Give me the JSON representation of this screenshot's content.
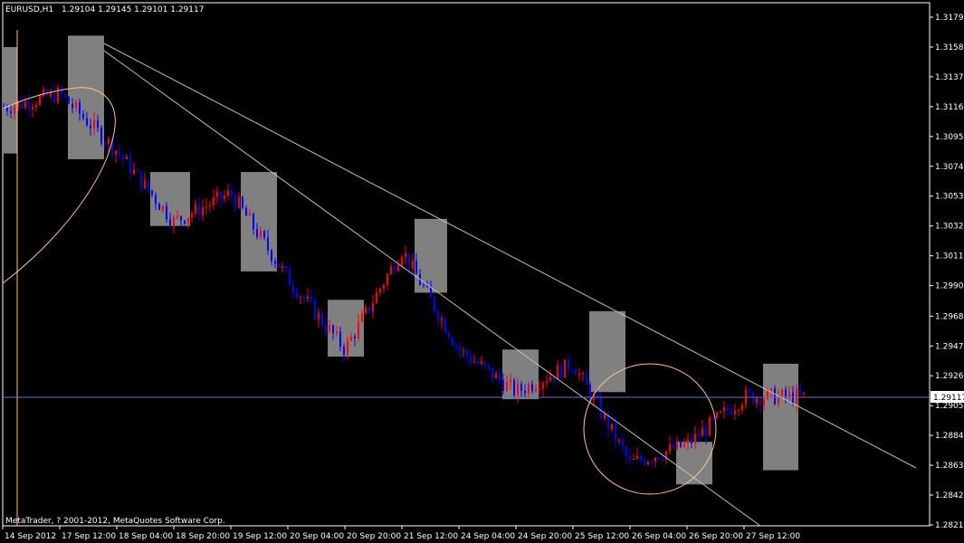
{
  "header": {
    "symbol_tf": "EURUSD,H1",
    "ohlc": "1.29104 1.29145 1.29101 1.29117"
  },
  "copyright": "MetaTrader, ? 2001-2012, MetaQuotes Software Corp.",
  "current_price_label": "1.29117",
  "colors": {
    "background": "#000000",
    "axis": "#ffffff",
    "bull_candle": "#ff0000",
    "bear_candle": "#0000ff",
    "box_fill": "#808080",
    "trendline": "#c0c0c0",
    "ellipse": "#ffc58a",
    "price_line": "#7070c0"
  },
  "chart_data": {
    "type": "candlestick",
    "symbol": "EURUSD",
    "timeframe": "H1",
    "ylim": [
      1.2815,
      1.318
    ],
    "y_ticks": [
      "1.31790",
      "1.31580",
      "1.31370",
      "1.31160",
      "1.30950",
      "1.30740",
      "1.30530",
      "1.30320",
      "1.30110",
      "1.29900",
      "1.29685",
      "1.29475",
      "1.29265",
      "1.29055",
      "1.28845",
      "1.28635",
      "1.28425",
      "1.28215"
    ],
    "x_ticks": [
      "14 Sep 2012",
      "17 Sep 12:00",
      "18 Sep 04:00",
      "18 Sep 20:00",
      "19 Sep 12:00",
      "20 Sep 04:00",
      "20 Sep 20:00",
      "21 Sep 12:00",
      "24 Sep 04:00",
      "24 Sep 20:00",
      "25 Sep 12:00",
      "26 Sep 04:00",
      "26 Sep 20:00",
      "27 Sep 12:00"
    ],
    "current_price": 1.29117,
    "approx_close_path": [
      {
        "time": "14 Sep 2012",
        "close": 1.3115
      },
      {
        "time": "17 Sep 12:00",
        "close": 1.3125
      },
      {
        "time": "18 Sep 04:00",
        "close": 1.3085
      },
      {
        "time": "18 Sep 20:00",
        "close": 1.3035
      },
      {
        "time": "19 Sep 12:00",
        "close": 1.3055
      },
      {
        "time": "20 Sep 04:00",
        "close": 1.2995
      },
      {
        "time": "20 Sep 20:00",
        "close": 1.2945
      },
      {
        "time": "21 Sep 12:00",
        "close": 1.3015
      },
      {
        "time": "24 Sep 04:00",
        "close": 1.2945
      },
      {
        "time": "24 Sep 20:00",
        "close": 1.2915
      },
      {
        "time": "25 Sep 12:00",
        "close": 1.2935
      },
      {
        "time": "26 Sep 04:00",
        "close": 1.2865
      },
      {
        "time": "26 Sep 20:00",
        "close": 1.2878
      },
      {
        "time": "27 Sep 12:00",
        "close": 1.29117
      }
    ]
  }
}
